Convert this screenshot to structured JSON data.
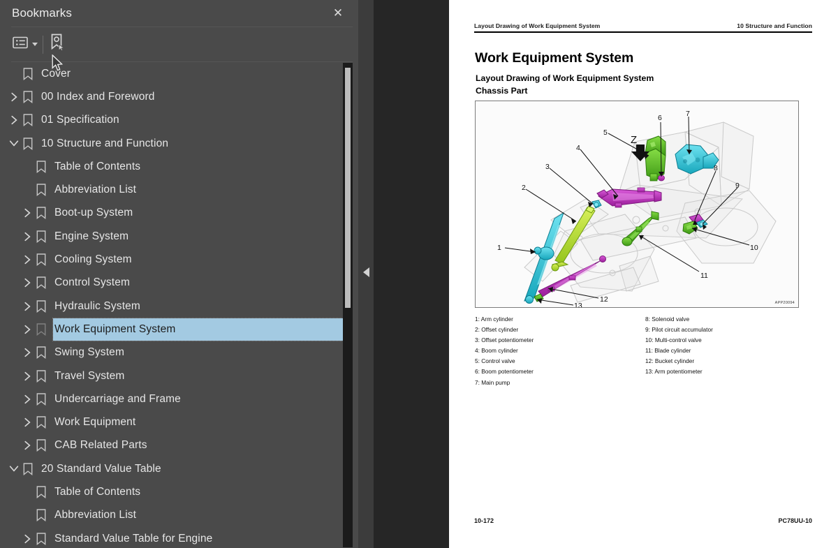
{
  "panel": {
    "title": "Bookmarks",
    "close_label": "✕",
    "toolbar": {
      "options_icon": "list-options-icon",
      "add_bookmark_icon": "add-bookmark-icon"
    },
    "tree": [
      {
        "label": "Cover",
        "depth": 1,
        "expander": "none",
        "selected": false
      },
      {
        "label": "00 Index and Foreword",
        "depth": 1,
        "expander": "collapsed",
        "selected": false
      },
      {
        "label": "01 Specification",
        "depth": 1,
        "expander": "collapsed",
        "selected": false
      },
      {
        "label": "10 Structure and Function",
        "depth": 1,
        "expander": "expanded",
        "selected": false
      },
      {
        "label": "Table of Contents",
        "depth": 2,
        "expander": "none",
        "selected": false
      },
      {
        "label": "Abbreviation List",
        "depth": 2,
        "expander": "none",
        "selected": false
      },
      {
        "label": "Boot-up System",
        "depth": 2,
        "expander": "collapsed",
        "selected": false
      },
      {
        "label": "Engine System",
        "depth": 2,
        "expander": "collapsed",
        "selected": false
      },
      {
        "label": "Cooling System",
        "depth": 2,
        "expander": "collapsed",
        "selected": false
      },
      {
        "label": "Control System",
        "depth": 2,
        "expander": "collapsed",
        "selected": false
      },
      {
        "label": "Hydraulic System",
        "depth": 2,
        "expander": "collapsed",
        "selected": false
      },
      {
        "label": "Work Equipment System",
        "depth": 2,
        "expander": "collapsed",
        "selected": true
      },
      {
        "label": "Swing System",
        "depth": 2,
        "expander": "collapsed",
        "selected": false
      },
      {
        "label": "Travel System",
        "depth": 2,
        "expander": "collapsed",
        "selected": false
      },
      {
        "label": "Undercarriage and Frame",
        "depth": 2,
        "expander": "collapsed",
        "selected": false
      },
      {
        "label": "Work Equipment",
        "depth": 2,
        "expander": "collapsed",
        "selected": false
      },
      {
        "label": "CAB Related Parts",
        "depth": 2,
        "expander": "collapsed",
        "selected": false
      },
      {
        "label": "20 Standard Value Table",
        "depth": 1,
        "expander": "expanded",
        "selected": false
      },
      {
        "label": "Table of Contents",
        "depth": 2,
        "expander": "none",
        "selected": false
      },
      {
        "label": "Abbreviation List",
        "depth": 2,
        "expander": "none",
        "selected": false
      },
      {
        "label": "Standard Value Table for Engine",
        "depth": 2,
        "expander": "collapsed",
        "selected": false
      }
    ]
  },
  "document": {
    "header_left": "Layout Drawing of Work Equipment System",
    "header_right": "10 Structure and Function",
    "title": "Work Equipment System",
    "subtitle_line1": "Layout Drawing of Work Equipment System",
    "subtitle_line2": "Chassis Part",
    "figure": {
      "code": "APP20094",
      "section_mark": "Z",
      "callouts": [
        "1",
        "2",
        "3",
        "4",
        "5",
        "6",
        "7",
        "8",
        "9",
        "10",
        "11",
        "12",
        "13"
      ]
    },
    "legend_left": [
      "1: Arm cylinder",
      "2: Offset cylinder",
      "3: Offset potentiometer",
      "4: Boom cylinder",
      "5: Control valve",
      "6: Boom potentiometer",
      "7: Main pump"
    ],
    "legend_right": [
      "8: Solenoid valve",
      "9: Pilot circuit accumulator",
      "10: Multi-control valve",
      "11: Blade cylinder",
      "12: Bucket cylinder",
      "13: Arm potentiometer"
    ],
    "footer_left": "10-172",
    "footer_right": "PC78UU-10"
  },
  "colors": {
    "panel_bg": "#4a4a4a",
    "selection": "#a3cae2",
    "viewer_bg": "#262626",
    "page_bg": "#ffffff",
    "part_magenta": "#c13cc1",
    "part_green": "#58c22c",
    "part_cyan": "#2fc3d6",
    "part_yellowgreen": "#b8e02a"
  }
}
